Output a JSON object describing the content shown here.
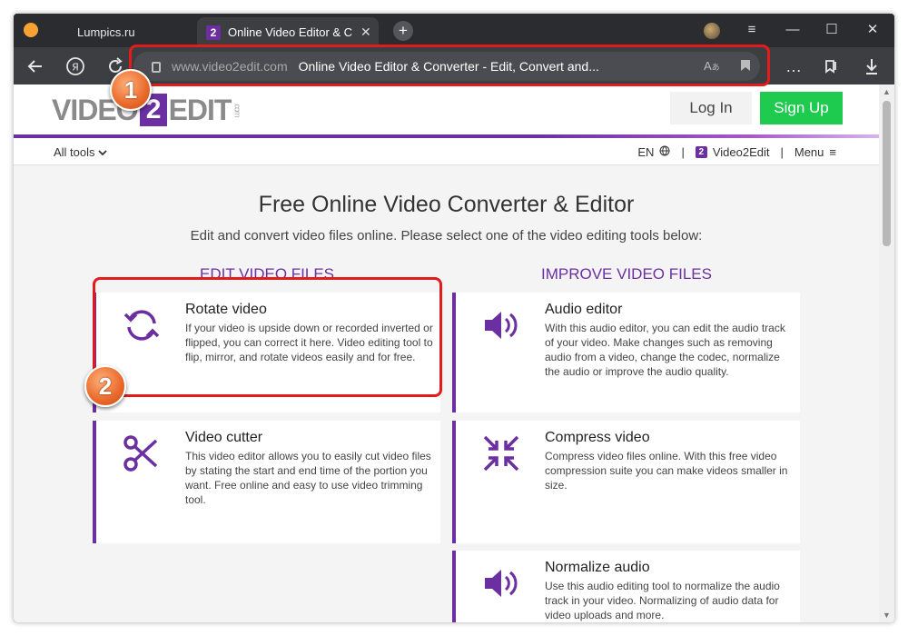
{
  "browser": {
    "tabs": [
      {
        "label": "Lumpics.ru"
      },
      {
        "favicon": "2",
        "label": "Online Video Editor & C"
      }
    ],
    "address": {
      "domain": "www.video2edit.com",
      "page_title": "Online Video Editor & Converter - Edit, Convert and..."
    },
    "window_controls": {
      "menu": "≡",
      "minimize": "—",
      "maximize": "☐",
      "close": "✕"
    },
    "icons": [
      "back-arrow-icon",
      "yandex-icon",
      "reload-icon",
      "lock-icon",
      "translate-icon",
      "bookmark-icon",
      "more-icon",
      "collections-icon",
      "download-icon"
    ]
  },
  "site": {
    "logo": {
      "left": "VIDEO",
      "mid": "2",
      "right": "EDIT",
      "suffix": ".com"
    },
    "login_label": "Log In",
    "signup_label": "Sign Up",
    "nav": {
      "all_tools": "All tools",
      "lang": "EN",
      "brand": "Video2Edit",
      "menu": "Menu",
      "sep": "|"
    },
    "title": "Free Online Video Converter & Editor",
    "subtitle": "Edit and convert video files online. Please select one of the video editing tools below:",
    "columns": {
      "left": "EDIT VIDEO FILES",
      "right": "IMPROVE VIDEO FILES"
    },
    "tools": {
      "rotate": {
        "title": "Rotate video",
        "desc": "If your video is upside down or recorded inverted or flipped, you can correct it here. Video editing tool to flip, mirror, and rotate videos easily and for free."
      },
      "cutter": {
        "title": "Video cutter",
        "desc": "This video editor allows you to easily cut video files by stating the start and end time of the portion you want. Free online and easy to use video trimming tool."
      },
      "audio": {
        "title": "Audio editor",
        "desc": "With this audio editor, you can edit the audio track of your video. Make changes such as removing audio from a video, change the codec, normalize the audio or improve the audio quality."
      },
      "compress": {
        "title": "Compress video",
        "desc": "Compress video files online. With this free video compression suite you can make videos smaller in size."
      },
      "normalize": {
        "title": "Normalize audio",
        "desc": "Use this audio editing tool to normalize the audio track in your video. Normalizing of audio data for video uploads and more."
      }
    }
  },
  "annotations": {
    "marker1": "1",
    "marker2": "2"
  },
  "colors": {
    "accent": "#6b2fa2",
    "signup": "#1fcb4f",
    "highlight": "#e21b1b"
  }
}
